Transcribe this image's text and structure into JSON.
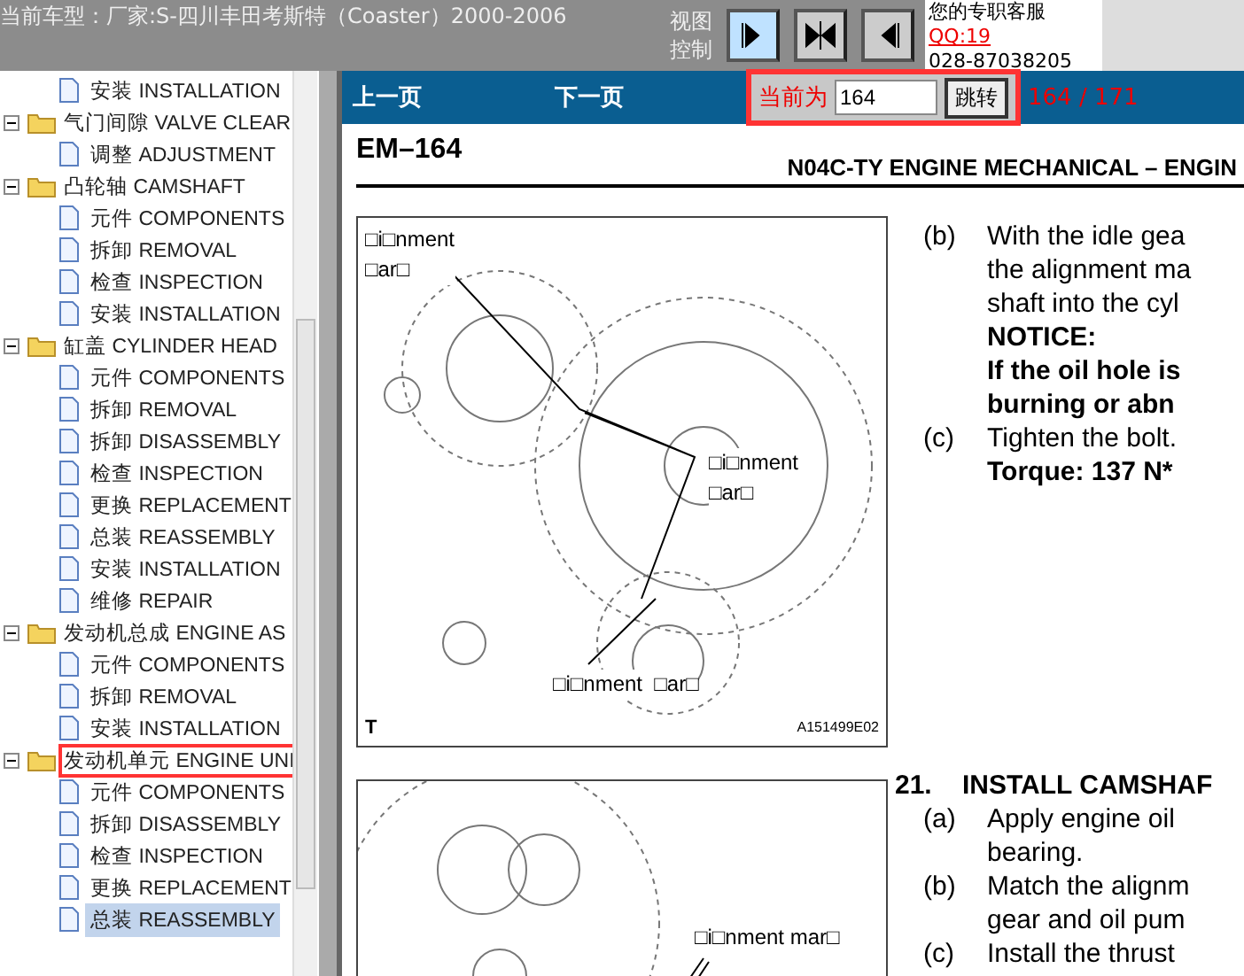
{
  "header": {
    "title": "当前车型：厂家:S-四川丰田考斯特（Coaster）2000-2006",
    "view_label": "视图控制",
    "service_label": "您的专职客服",
    "service_qq": "QQ:19",
    "service_phone": "028-87038205"
  },
  "view_buttons": [
    {
      "kind": "right",
      "selected": true
    },
    {
      "kind": "both",
      "selected": false
    },
    {
      "kind": "left",
      "selected": false
    }
  ],
  "tree": [
    {
      "kind": "page",
      "label": "安装 INSTALLATION",
      "selected": false,
      "annotated": false
    },
    {
      "kind": "folder",
      "label": "气门间隙 VALVE CLEAR",
      "expanded": true,
      "selected": false,
      "annotated": false,
      "children": [
        {
          "kind": "page",
          "label": "调整 ADJUSTMENT",
          "selected": false,
          "annotated": false
        }
      ]
    },
    {
      "kind": "folder",
      "label": "凸轮轴 CAMSHAFT",
      "expanded": true,
      "selected": false,
      "annotated": false,
      "children": [
        {
          "kind": "page",
          "label": "元件 COMPONENTS",
          "selected": false,
          "annotated": false
        },
        {
          "kind": "page",
          "label": "拆卸 REMOVAL",
          "selected": false,
          "annotated": false
        },
        {
          "kind": "page",
          "label": "检查 INSPECTION",
          "selected": false,
          "annotated": false
        },
        {
          "kind": "page",
          "label": "安装 INSTALLATION",
          "selected": false,
          "annotated": false
        }
      ]
    },
    {
      "kind": "folder",
      "label": "缸盖 CYLINDER HEAD",
      "expanded": true,
      "selected": false,
      "annotated": false,
      "children": [
        {
          "kind": "page",
          "label": "元件 COMPONENTS",
          "selected": false,
          "annotated": false
        },
        {
          "kind": "page",
          "label": "拆卸 REMOVAL",
          "selected": false,
          "annotated": false
        },
        {
          "kind": "page",
          "label": "拆卸 DISASSEMBLY",
          "selected": false,
          "annotated": false
        },
        {
          "kind": "page",
          "label": "检查 INSPECTION",
          "selected": false,
          "annotated": false
        },
        {
          "kind": "page",
          "label": "更换 REPLACEMENT",
          "selected": false,
          "annotated": false
        },
        {
          "kind": "page",
          "label": "总装 REASSEMBLY",
          "selected": false,
          "annotated": false
        },
        {
          "kind": "page",
          "label": "安装 INSTALLATION",
          "selected": false,
          "annotated": false
        },
        {
          "kind": "page",
          "label": "维修 REPAIR",
          "selected": false,
          "annotated": false
        }
      ]
    },
    {
      "kind": "folder",
      "label": "发动机总成 ENGINE AS",
      "expanded": true,
      "selected": false,
      "annotated": false,
      "children": [
        {
          "kind": "page",
          "label": "元件 COMPONENTS",
          "selected": false,
          "annotated": false
        },
        {
          "kind": "page",
          "label": "拆卸 REMOVAL",
          "selected": false,
          "annotated": false
        },
        {
          "kind": "page",
          "label": "安装 INSTALLATION",
          "selected": false,
          "annotated": false
        }
      ]
    },
    {
      "kind": "folder",
      "label": "发动机单元 ENGINE UNI",
      "expanded": true,
      "selected": false,
      "annotated": true,
      "children": [
        {
          "kind": "page",
          "label": "元件 COMPONENTS",
          "selected": false,
          "annotated": false
        },
        {
          "kind": "page",
          "label": "拆卸 DISASSEMBLY",
          "selected": false,
          "annotated": false
        },
        {
          "kind": "page",
          "label": "检查 INSPECTION",
          "selected": false,
          "annotated": false
        },
        {
          "kind": "page",
          "label": "更换 REPLACEMENT",
          "selected": false,
          "annotated": false
        },
        {
          "kind": "page",
          "label": "总装 REASSEMBLY",
          "selected": true,
          "annotated": false
        }
      ]
    }
  ],
  "pager": {
    "prev": "上一页",
    "next": "下一页",
    "current_label": "当前为",
    "page_value": "164",
    "go": "跳转",
    "count": "164 / 171",
    "annotated": true
  },
  "document": {
    "page_id": "EM–164",
    "section": "N04C-TY ENGINE MECHANICAL  –  ENGIN",
    "figures": [
      {
        "labels": [
          "□i□nment\n□ar□",
          "□i□nment\n□ar□",
          "□i□nment  □ar□"
        ],
        "corner": "T",
        "code": "A151499E02"
      },
      {
        "labels": [
          "□i□nment mar□"
        ]
      }
    ],
    "blocks": [
      {
        "kind": "step",
        "label": "(b)",
        "lines": [
          "With the idle gea",
          "the alignment ma",
          "shaft into the cyl"
        ]
      },
      {
        "kind": "notice",
        "lines": [
          "NOTICE:",
          "If the oil hole is",
          "burning or abn"
        ]
      },
      {
        "kind": "step",
        "label": "(c)",
        "lines": [
          "Tighten the bolt."
        ]
      },
      {
        "kind": "notice",
        "lines": [
          "Torque: 137 N*"
        ]
      },
      {
        "kind": "heading",
        "label": "21.",
        "lines": [
          "INSTALL CAMSHAF"
        ]
      },
      {
        "kind": "step",
        "label": "(a)",
        "lines": [
          "Apply engine oil",
          "bearing."
        ]
      },
      {
        "kind": "step",
        "label": "(b)",
        "lines": [
          "Match the alignm",
          "gear and oil pum"
        ]
      },
      {
        "kind": "step",
        "label": "(c)",
        "lines": [
          "Install the thrust"
        ]
      }
    ]
  }
}
